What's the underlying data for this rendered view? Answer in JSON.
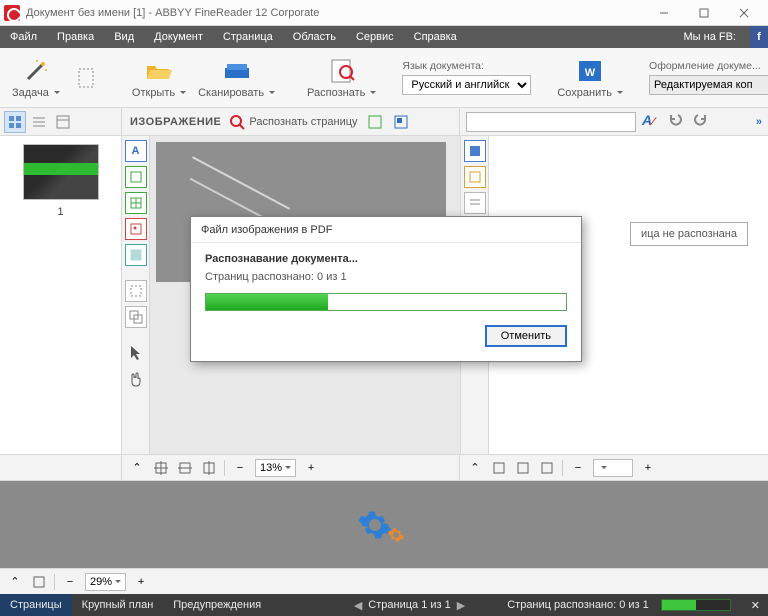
{
  "title": "Документ без имени [1] - ABBYY FineReader 12 Corporate",
  "menus": [
    "Файл",
    "Правка",
    "Вид",
    "Документ",
    "Страница",
    "Область",
    "Сервис",
    "Справка"
  ],
  "fb_label": "Мы на FB:",
  "ribbon": {
    "task": "Задача",
    "open": "Открыть",
    "scan": "Сканировать",
    "recognize": "Распознать",
    "lang_label": "Язык документа:",
    "lang_value": "Русский и английск",
    "save": "Сохранить",
    "design_label": "Оформление докуме...",
    "design_value": "Редактируемая коп"
  },
  "toolstrip": {
    "image_header": "ИЗОБРАЖЕНИЕ",
    "recognize_page": "Распознать страницу"
  },
  "thumb_num": "1",
  "rightpane_msg": "ица не распознана",
  "zoom_center": "13%",
  "zoom_preview": "29%",
  "dialog": {
    "title": "Файл изображения в PDF",
    "header": "Распознавание документа...",
    "msg": "Страниц распознано: 0 из 1",
    "cancel": "Отменить"
  },
  "status": {
    "tab1": "Страницы",
    "tab2": "Крупный план",
    "tab3": "Предупреждения",
    "page": "Страница 1 из 1",
    "recognized": "Страниц распознано: 0 из 1"
  }
}
